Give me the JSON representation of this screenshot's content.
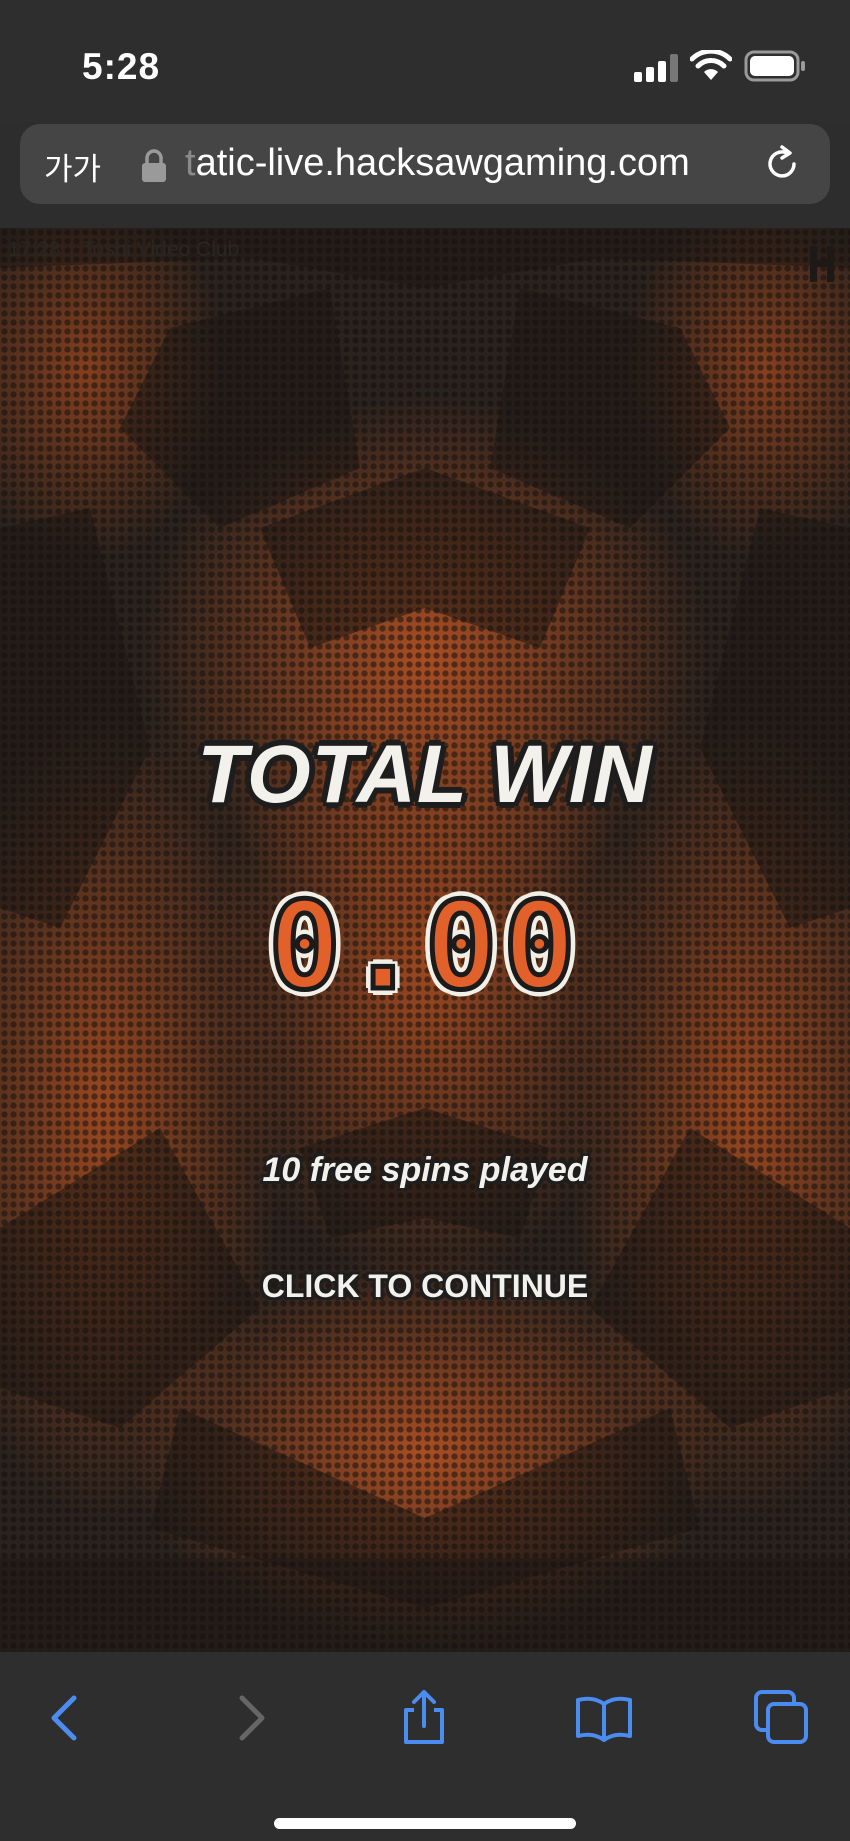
{
  "status_bar": {
    "time": "5:28"
  },
  "browser": {
    "reader_label": "가가",
    "url_faded_prefix": "t",
    "url_main": "atic-live.hacksawgaming.com"
  },
  "game": {
    "clock": "17:28",
    "separator": "|",
    "title": "Toshi Video Club",
    "total_win_label": "TOTAL WIN",
    "total_win_amount": "0.00",
    "spins_played": "10 free spins played",
    "continue_label": "CLICK TO CONTINUE"
  },
  "colors": {
    "accent_orange": "#e2612a",
    "background_dark": "#2a221d",
    "ios_blue": "#4a8cf0"
  },
  "icons": [
    "lock-icon",
    "reload-icon",
    "back-icon",
    "forward-icon",
    "share-icon",
    "bookmarks-icon",
    "tabs-icon"
  ]
}
